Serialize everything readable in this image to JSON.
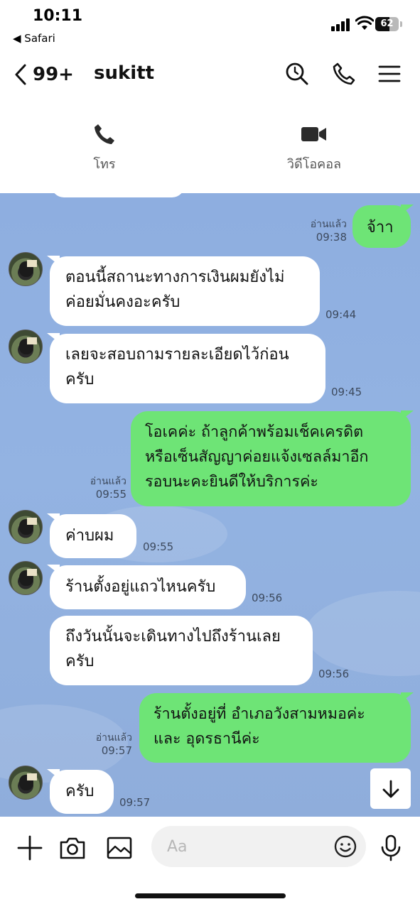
{
  "status_bar": {
    "time": "10:11",
    "back_app": "◀ Safari",
    "battery": "62",
    "battery_level": 0.62
  },
  "header": {
    "back_count": "99+",
    "title": "sukitt"
  },
  "call_options": {
    "voice_label": "โทร",
    "video_label": "วิดีโอคอล"
  },
  "messages": [
    {
      "side": "out",
      "text": "จ้าา",
      "read": "อ่านแล้ว",
      "time": "09:38"
    },
    {
      "side": "in",
      "line1": "ตอนนี้สถานะทางการเงินผมยังไม่",
      "line2": "ค่อยมั่นคงอะครับ",
      "time": "09:44"
    },
    {
      "side": "in",
      "line1": "เลยจะสอบถามรายละเอียดไว้ก่อน",
      "line2": "ครับ",
      "time": "09:45"
    },
    {
      "side": "out",
      "line1": "โอเคค่ะ ถ้าลูกค้าพร้อมเช็คเครดิต",
      "line2": "หรือเซ็นสัญญาค่อยแจ้งเซลล์มาอีก",
      "line3": "รอบนะคะยินดีให้บริการค่ะ",
      "read": "อ่านแล้ว",
      "time": "09:55"
    },
    {
      "side": "in",
      "text": "ค่าบผม",
      "time": "09:55"
    },
    {
      "side": "in",
      "text": "ร้านตั้งอยู่แถวไหนครับ",
      "time": "09:56"
    },
    {
      "side": "in",
      "line1": "ถึงวันนั้นจะเดินทางไปถึงร้านเลย",
      "line2": "ครับ",
      "time": "09:56"
    },
    {
      "side": "out",
      "line1": "ร้านตั้งอยู่ที่ อำเภอวังสามหมอค่ะ",
      "line2": "และ อุดรธานีค่ะ",
      "read": "อ่านแล้ว",
      "time": "09:57"
    },
    {
      "side": "in",
      "text": "ครับ",
      "time": "09:57"
    }
  ],
  "composer": {
    "placeholder": "Aa"
  },
  "colors": {
    "chat_background": "#8eaee0",
    "outgoing_bubble": "#6ee476",
    "incoming_bubble": "#ffffff"
  },
  "icons": {
    "header": [
      "chevron-left-icon",
      "search-icon",
      "phone-icon",
      "menu-icon"
    ],
    "call_strip": [
      "phone-icon",
      "video-camera-icon"
    ],
    "bottom_bar": [
      "plus-icon",
      "camera-icon",
      "image-icon",
      "emoji-icon",
      "microphone-icon"
    ],
    "scroll": "arrow-down-icon"
  }
}
